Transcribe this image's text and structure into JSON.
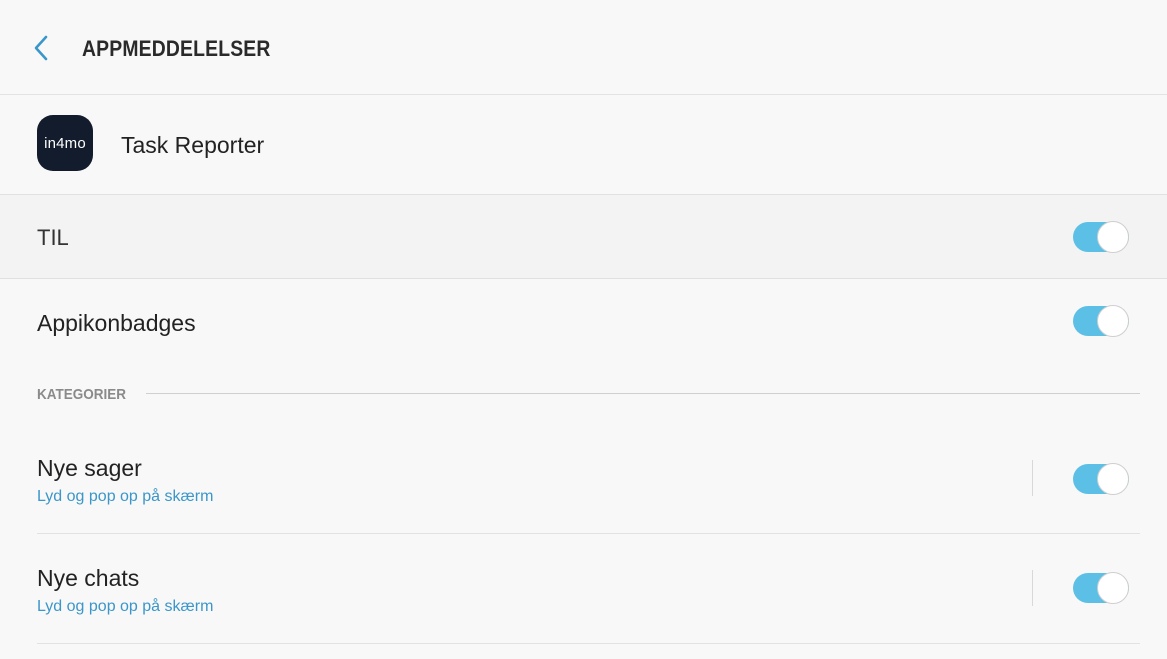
{
  "header": {
    "title": "APPMEDDELELSER",
    "back_icon": "chevron-left-icon"
  },
  "app": {
    "icon_text": "in4mo",
    "name": "Task Reporter"
  },
  "master_toggle": {
    "label": "TIL",
    "on": true
  },
  "badges": {
    "label": "Appikonbadges",
    "on": true
  },
  "categories": {
    "header": "KATEGORIER",
    "items": [
      {
        "title": "Nye sager",
        "subtitle": "Lyd og pop op på skærm",
        "on": true
      },
      {
        "title": "Nye chats",
        "subtitle": "Lyd og pop op på skærm",
        "on": true
      }
    ]
  },
  "colors": {
    "accent": "#5cc0e6",
    "link": "#3b96c9",
    "app_icon_bg": "#121c2c"
  }
}
